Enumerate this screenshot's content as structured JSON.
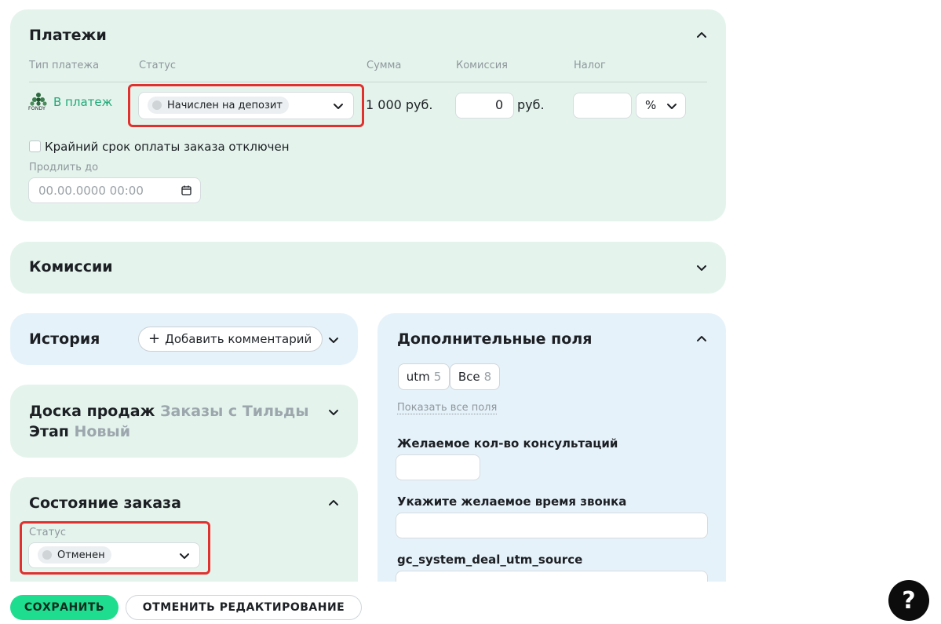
{
  "payments": {
    "title": "Платежи",
    "headers": {
      "type": "Тип платежа",
      "status": "Статус",
      "sum": "Сумма",
      "commission": "Комиссия",
      "tax": "Налог"
    },
    "row": {
      "provider_logo_text": "FONDY",
      "type_link": "В платеж",
      "status_value": "Начислен на депозит",
      "sum_value": "1 000 руб.",
      "commission_value": "0",
      "commission_unit": "руб.",
      "tax_value": "",
      "tax_unit": "%"
    },
    "deadline_checkbox_label": "Крайний срок оплаты заказа отключен",
    "deadline_checked": false,
    "extend_label": "Продлить до",
    "extend_placeholder": "00.00.0000 00:00"
  },
  "commissions": {
    "title": "Комиссии"
  },
  "history": {
    "title": "История",
    "add_comment_label": "Добавить комментарий"
  },
  "sales_board": {
    "board_label": "Доска продаж",
    "board_value": "Заказы с Тильды",
    "stage_label": "Этап",
    "stage_value": "Новый"
  },
  "order_state": {
    "title": "Состояние заказа",
    "status_label": "Статус",
    "status_value": "Отменен"
  },
  "extra_fields": {
    "title": "Дополнительные поля",
    "tabs": [
      {
        "label": "utm",
        "count": "5"
      },
      {
        "label": "Все",
        "count": "8"
      }
    ],
    "show_all_link": "Показать все поля",
    "fields": [
      {
        "label": "Желаемое кол-во консультаций",
        "value": ""
      },
      {
        "label": "Укажите желаемое время звонка",
        "value": ""
      },
      {
        "label": "gc_system_deal_utm_source",
        "value": ""
      }
    ]
  },
  "footer": {
    "save_label": "СОХРАНИТЬ",
    "cancel_label": "ОТМЕНИТЬ РЕДАКТИРОВАНИЕ",
    "help_label": "?"
  },
  "colors": {
    "card_green": "#e4f4ec",
    "card_blue": "#e6f2fa",
    "accent_green": "#1fdd8f",
    "link_green": "#1fa878",
    "highlight_red": "#e0312f"
  }
}
